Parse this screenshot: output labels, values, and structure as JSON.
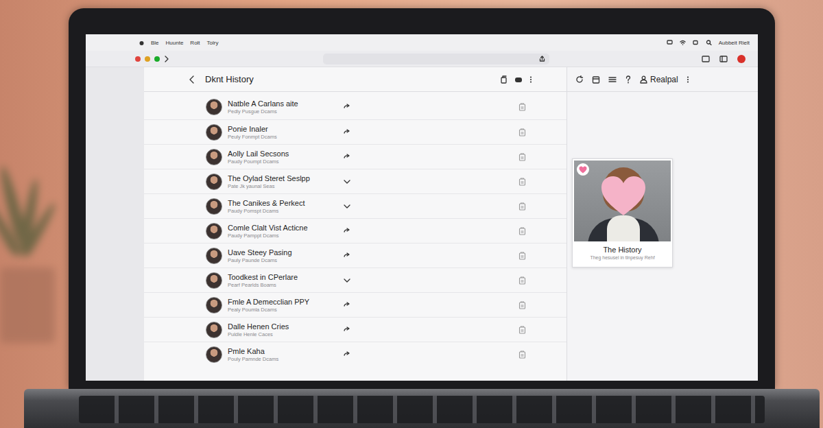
{
  "menubar": {
    "items": [
      "Ble",
      "Huunte",
      "Rolt",
      "Tolry"
    ],
    "account": "Aubbeit Rielt"
  },
  "toolbar": {
    "title": "Dknt History"
  },
  "side_toolbar": {
    "label": "Realpal"
  },
  "rows": [
    {
      "title": "Natble A Carlans aite",
      "subtitle": "Pedly Pusgue Dcams",
      "kind": "arrow"
    },
    {
      "title": "Ponie Inaler",
      "subtitle": "Peuly Fonmpt Dcams",
      "kind": "arrow"
    },
    {
      "title": "Aolly Lail Secsons",
      "subtitle": "Paudy Poumpt Dcams",
      "kind": "arrow"
    },
    {
      "title": "The Oylad Steret Seslpp",
      "subtitle": "Pate Jk yaunal Seas",
      "kind": "chevron"
    },
    {
      "title": "The Canikes & Perkect",
      "subtitle": "Paudy Pomspt Dcams",
      "kind": "chevron"
    },
    {
      "title": "Comle Clalt Vist Acticne",
      "subtitle": "Paudy Pamppt Dcams",
      "kind": "arrow"
    },
    {
      "title": "Uave Steey Pasing",
      "subtitle": "Pauly Paunde Dcams",
      "kind": "arrow"
    },
    {
      "title": "Toodkest in CPerlare",
      "subtitle": "Pearf Pearlds Boams",
      "kind": "chevron"
    },
    {
      "title": "Fmle A Demecclian PPY",
      "subtitle": "Pealy Poumla Dcams",
      "kind": "arrow"
    },
    {
      "title": "Dalle Henen Cries",
      "subtitle": "Puldle Henle Caces",
      "kind": "arrow"
    },
    {
      "title": "Pmle Kaha",
      "subtitle": "Pouly Pamnde Dcams",
      "kind": "arrow"
    }
  ],
  "card": {
    "title": "The History",
    "subtitle": "Theg hesusel in tlnpesuy Rehf"
  }
}
